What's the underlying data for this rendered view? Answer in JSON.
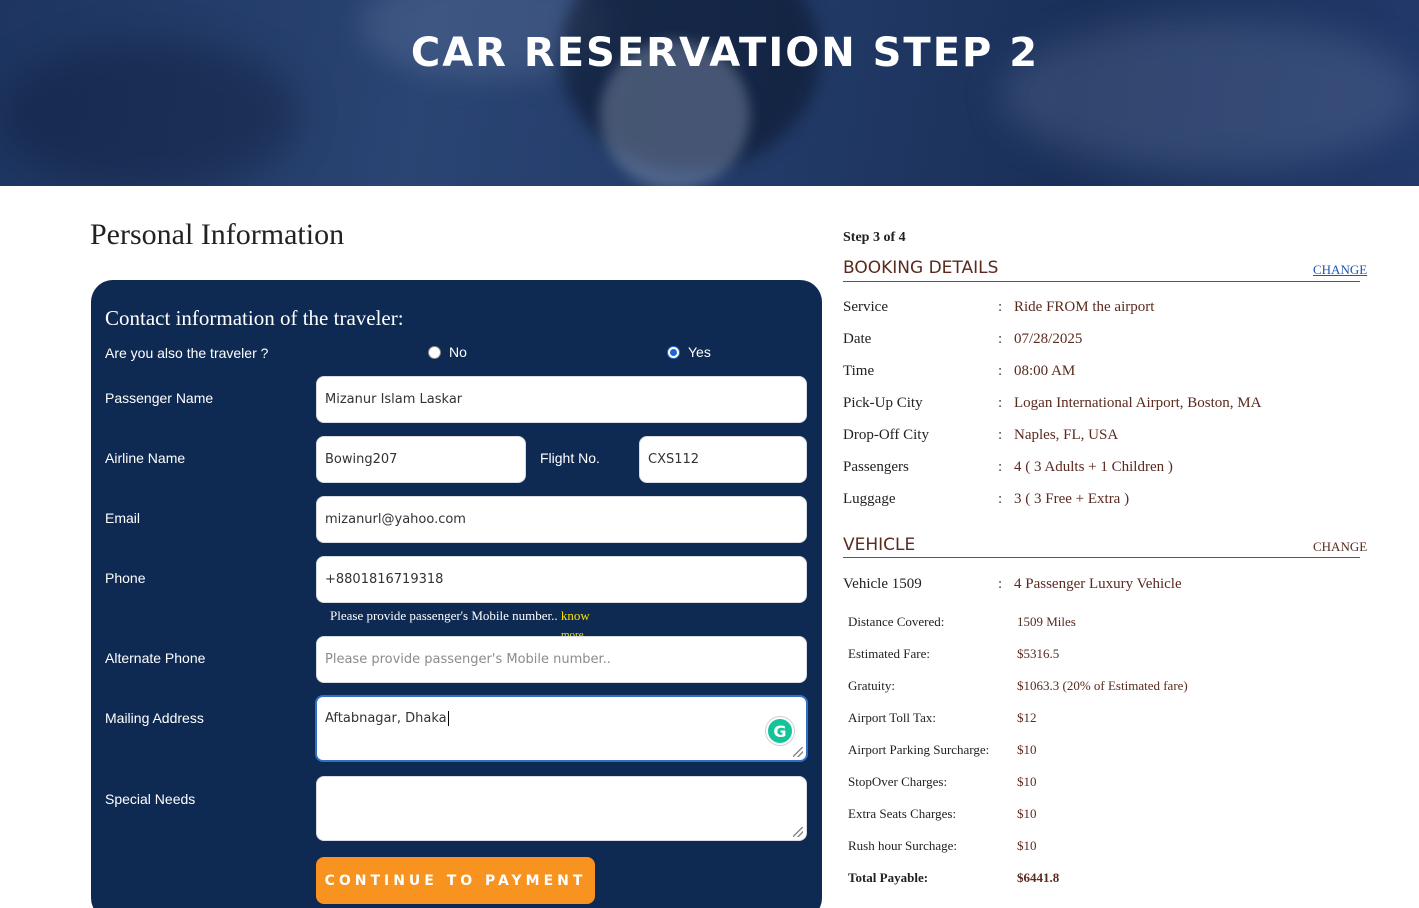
{
  "hero": {
    "title": "CAR RESERVATION STEP 2"
  },
  "personal": {
    "title": "Personal Information",
    "card_title": "Contact information of the traveler:",
    "traveler_question": "Are you also the traveler ?",
    "options": {
      "no": "No",
      "yes": "Yes",
      "selected": "yes"
    },
    "labels": {
      "passenger_name": "Passenger Name",
      "airline_name": "Airline Name",
      "flight_no": "Flight No.",
      "email": "Email",
      "phone": "Phone",
      "alternate_phone": "Alternate Phone",
      "mailing_address": "Mailing Address",
      "special_needs": "Special Needs"
    },
    "values": {
      "passenger_name": "Mizanur Islam Laskar",
      "airline_name": "Bowing207",
      "flight_no": "CXS112",
      "email": "mizanurl@yahoo.com",
      "phone": "+8801816719318",
      "alternate_phone": "",
      "mailing_address": "Aftabnagar, Dhaka",
      "special_needs": ""
    },
    "placeholders": {
      "alternate_phone": "Please provide passenger's Mobile number.."
    },
    "phone_hint": "Please provide passenger's Mobile number..",
    "hint_link": "know",
    "hint_link_cut": "more",
    "grammarly_icon": "G",
    "continue_label": "CONTINUE TO PAYMENT"
  },
  "summary": {
    "step": "Step 3 of 4",
    "booking": {
      "title": "BOOKING DETAILS",
      "change": "CHANGE",
      "rows": [
        {
          "label": "Service",
          "value": "Ride FROM the airport"
        },
        {
          "label": "Date",
          "value": "07/28/2025"
        },
        {
          "label": "Time",
          "value": "08:00 AM"
        },
        {
          "label": "Pick-Up City",
          "value": "Logan International Airport, Boston, MA"
        },
        {
          "label": "Drop-Off City",
          "value": "Naples, FL, USA"
        },
        {
          "label": "Passengers",
          "value": "4 ( 3 Adults + 1 Children )"
        },
        {
          "label": "Luggage",
          "value": "3 ( 3 Free + Extra )"
        }
      ]
    },
    "vehicle": {
      "title": "VEHICLE",
      "change": "CHANGE",
      "label": "Vehicle 1509",
      "value": "4 Passenger Luxury Vehicle"
    },
    "colon": ":",
    "fares": [
      {
        "label": "Distance Covered:",
        "value": "1509 Miles"
      },
      {
        "label": "Estimated Fare:",
        "value": "$5316.5"
      },
      {
        "label": "Gratuity:",
        "value": "$1063.3 (20% of Estimated fare)"
      },
      {
        "label": "Airport Toll Tax:",
        "value": "$12"
      },
      {
        "label": "Airport Parking Surcharge:",
        "value": "$10"
      },
      {
        "label": "StopOver Charges:",
        "value": "$10"
      },
      {
        "label": "Extra Seats Charges:",
        "value": "$10"
      },
      {
        "label": "Rush hour Surchage:",
        "value": "$10"
      },
      {
        "label": "Total Payable:",
        "value": "$6441.8"
      }
    ]
  }
}
